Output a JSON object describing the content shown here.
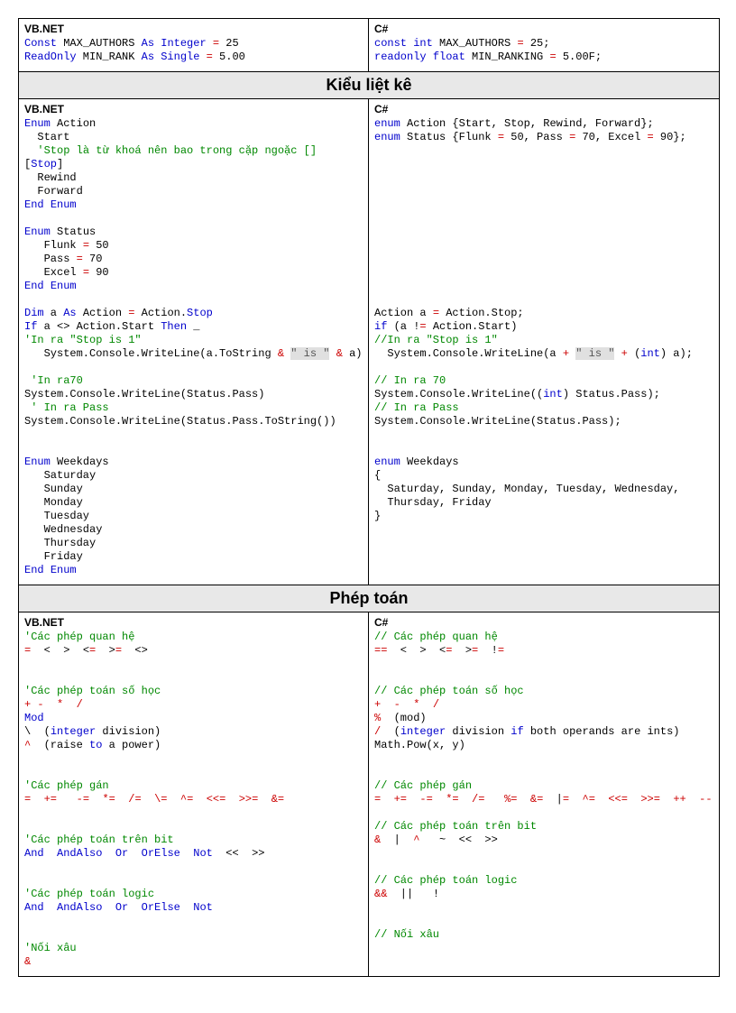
{
  "sections": [
    {
      "header": null,
      "left_lang": "VB.NET",
      "right_lang": "C#",
      "left_tokens": [
        [
          "kw",
          "Const"
        ],
        [
          "plain",
          " MAX_AUTHORS "
        ],
        [
          "kw",
          "As"
        ],
        [
          "plain",
          " "
        ],
        [
          "kw",
          "Integer"
        ],
        [
          "plain",
          " "
        ],
        [
          "op",
          "="
        ],
        [
          "plain",
          " 25\n"
        ],
        [
          "kw",
          "ReadOnly"
        ],
        [
          "plain",
          " MIN_RANK "
        ],
        [
          "kw",
          "As"
        ],
        [
          "plain",
          " "
        ],
        [
          "kw",
          "Single"
        ],
        [
          "plain",
          " "
        ],
        [
          "op",
          "="
        ],
        [
          "plain",
          " 5.00"
        ]
      ],
      "right_tokens": [
        [
          "kw",
          "const"
        ],
        [
          "plain",
          " "
        ],
        [
          "kw",
          "int"
        ],
        [
          "plain",
          " MAX_AUTHORS "
        ],
        [
          "op",
          "="
        ],
        [
          "plain",
          " 25;\n"
        ],
        [
          "kw",
          "readonly"
        ],
        [
          "plain",
          " "
        ],
        [
          "kw",
          "float"
        ],
        [
          "plain",
          " MIN_RANKING "
        ],
        [
          "op",
          "="
        ],
        [
          "plain",
          " 5.00F;"
        ]
      ]
    },
    {
      "header": "Kiểu liệt kê",
      "left_lang": "VB.NET",
      "right_lang": "C#",
      "left_tokens": [
        [
          "kw",
          "Enum"
        ],
        [
          "plain",
          " Action\n  Start\n  "
        ],
        [
          "cm",
          "'Stop là từ khoá nên bao trong cặp ngoặc []"
        ],
        [
          "plain",
          "\n["
        ],
        [
          "kw",
          "Stop"
        ],
        [
          "plain",
          "]\n  Rewind\n  Forward\n"
        ],
        [
          "kw",
          "End"
        ],
        [
          "plain",
          " "
        ],
        [
          "kw",
          "Enum"
        ],
        [
          "plain",
          "\n\n"
        ],
        [
          "kw",
          "Enum"
        ],
        [
          "plain",
          " Status\n   Flunk "
        ],
        [
          "op",
          "="
        ],
        [
          "plain",
          " 50\n   Pass "
        ],
        [
          "op",
          "="
        ],
        [
          "plain",
          " 70\n   Excel "
        ],
        [
          "op",
          "="
        ],
        [
          "plain",
          " 90\n"
        ],
        [
          "kw",
          "End"
        ],
        [
          "plain",
          " "
        ],
        [
          "kw",
          "Enum"
        ],
        [
          "plain",
          "\n\n"
        ],
        [
          "kw",
          "Dim"
        ],
        [
          "plain",
          " a "
        ],
        [
          "kw",
          "As"
        ],
        [
          "plain",
          " Action "
        ],
        [
          "op",
          "="
        ],
        [
          "plain",
          " Action."
        ],
        [
          "kw",
          "Stop"
        ],
        [
          "plain",
          "\n"
        ],
        [
          "kw",
          "If"
        ],
        [
          "plain",
          " a <> Action.Start "
        ],
        [
          "kw",
          "Then"
        ],
        [
          "plain",
          " _\n"
        ],
        [
          "cm",
          "'In ra \"Stop is 1\""
        ],
        [
          "plain",
          "\n   System.Console.WriteLine(a.ToString "
        ],
        [
          "op",
          "&"
        ],
        [
          "plain",
          " "
        ],
        [
          "str",
          "\" is \""
        ],
        [
          "plain",
          " "
        ],
        [
          "op",
          "&"
        ],
        [
          "plain",
          " a)\n\n"
        ],
        [
          "cm",
          " 'In ra70"
        ],
        [
          "plain",
          "\nSystem.Console.WriteLine(Status.Pass)\n"
        ],
        [
          "cm",
          " ' In ra Pass"
        ],
        [
          "plain",
          "\nSystem.Console.WriteLine(Status.Pass.ToString())\n\n\n"
        ],
        [
          "kw",
          "Enum"
        ],
        [
          "plain",
          " Weekdays\n   Saturday\n   Sunday\n   Monday\n   Tuesday\n   Wednesday\n   Thursday\n   Friday\n"
        ],
        [
          "kw",
          "End"
        ],
        [
          "plain",
          " "
        ],
        [
          "kw",
          "Enum"
        ]
      ],
      "right_tokens": [
        [
          "kw",
          "enum"
        ],
        [
          "plain",
          " Action {Start, Stop, Rewind, Forward};\n"
        ],
        [
          "kw",
          "enum"
        ],
        [
          "plain",
          " Status {Flunk "
        ],
        [
          "op",
          "="
        ],
        [
          "plain",
          " 50, Pass "
        ],
        [
          "op",
          "="
        ],
        [
          "plain",
          " 70, Excel "
        ],
        [
          "op",
          "="
        ],
        [
          "plain",
          " 90};\n\n\n\n\n\n\n\n\n\n\n\n\n"
        ],
        [
          "plain",
          "Action a "
        ],
        [
          "op",
          "="
        ],
        [
          "plain",
          " Action.Stop;\n"
        ],
        [
          "kw",
          "if"
        ],
        [
          "plain",
          " (a !"
        ],
        [
          "op",
          "="
        ],
        [
          "plain",
          " Action.Start)\n"
        ],
        [
          "cm",
          "//In ra \"Stop is 1\""
        ],
        [
          "plain",
          "\n  System.Console.WriteLine(a "
        ],
        [
          "op",
          "+"
        ],
        [
          "plain",
          " "
        ],
        [
          "str",
          "\" is \""
        ],
        [
          "plain",
          " "
        ],
        [
          "op",
          "+"
        ],
        [
          "plain",
          " ("
        ],
        [
          "kw",
          "int"
        ],
        [
          "plain",
          ") a);\n\n"
        ],
        [
          "cm",
          "// In ra 70"
        ],
        [
          "plain",
          "\nSystem.Console.WriteLine(("
        ],
        [
          "kw",
          "int"
        ],
        [
          "plain",
          ") Status.Pass);\n"
        ],
        [
          "cm",
          "// In ra Pass"
        ],
        [
          "plain",
          "\nSystem.Console.WriteLine(Status.Pass);\n\n\n"
        ],
        [
          "kw",
          "enum"
        ],
        [
          "plain",
          " Weekdays\n{\n  Saturday, Sunday, Monday, Tuesday, Wednesday,\n  Thursday, Friday\n}"
        ]
      ]
    },
    {
      "header": "Phép toán",
      "left_lang": "VB.NET",
      "right_lang": "C#",
      "left_tokens": [
        [
          "cm",
          "'Các phép quan hệ"
        ],
        [
          "plain",
          "\n"
        ],
        [
          "op",
          "="
        ],
        [
          "plain",
          "  <  >  <"
        ],
        [
          "op",
          "="
        ],
        [
          "plain",
          "  >"
        ],
        [
          "op",
          "="
        ],
        [
          "plain",
          "  <>\n\n\n"
        ],
        [
          "cm",
          "'Các phép toán số học"
        ],
        [
          "plain",
          "\n"
        ],
        [
          "op",
          "+"
        ],
        [
          "plain",
          " "
        ],
        [
          "op",
          "-"
        ],
        [
          "plain",
          "  "
        ],
        [
          "op",
          "*"
        ],
        [
          "plain",
          "  "
        ],
        [
          "op",
          "/"
        ],
        [
          "plain",
          "\n"
        ],
        [
          "kw",
          "Mod"
        ],
        [
          "plain",
          "\n\\  ("
        ],
        [
          "kw",
          "integer"
        ],
        [
          "plain",
          " division)\n"
        ],
        [
          "op",
          "^"
        ],
        [
          "plain",
          "  (raise "
        ],
        [
          "kw",
          "to"
        ],
        [
          "plain",
          " a power)\n\n\n"
        ],
        [
          "cm",
          "'Các phép gán"
        ],
        [
          "plain",
          "\n"
        ],
        [
          "op",
          "="
        ],
        [
          "plain",
          "  "
        ],
        [
          "op",
          "+="
        ],
        [
          "plain",
          "   "
        ],
        [
          "op",
          "-="
        ],
        [
          "plain",
          "  "
        ],
        [
          "op",
          "*="
        ],
        [
          "plain",
          "  "
        ],
        [
          "op",
          "/="
        ],
        [
          "plain",
          "  "
        ],
        [
          "op",
          "\\="
        ],
        [
          "plain",
          "  "
        ],
        [
          "op",
          "^="
        ],
        [
          "plain",
          "  "
        ],
        [
          "op",
          "<<="
        ],
        [
          "plain",
          "  "
        ],
        [
          "op",
          ">>="
        ],
        [
          "plain",
          "  "
        ],
        [
          "op",
          "&="
        ],
        [
          "plain",
          "\n\n\n"
        ],
        [
          "cm",
          "'Các phép toán trên bit"
        ],
        [
          "plain",
          "\n"
        ],
        [
          "kw",
          "And"
        ],
        [
          "plain",
          "  "
        ],
        [
          "kw",
          "AndAlso"
        ],
        [
          "plain",
          "  "
        ],
        [
          "kw",
          "Or"
        ],
        [
          "plain",
          "  "
        ],
        [
          "kw",
          "OrElse"
        ],
        [
          "plain",
          "  "
        ],
        [
          "kw",
          "Not"
        ],
        [
          "plain",
          "  <<  >>\n\n\n"
        ],
        [
          "cm",
          "'Các phép toán logic"
        ],
        [
          "plain",
          "\n"
        ],
        [
          "kw",
          "And"
        ],
        [
          "plain",
          "  "
        ],
        [
          "kw",
          "AndAlso"
        ],
        [
          "plain",
          "  "
        ],
        [
          "kw",
          "Or"
        ],
        [
          "plain",
          "  "
        ],
        [
          "kw",
          "OrElse"
        ],
        [
          "plain",
          "  "
        ],
        [
          "kw",
          "Not"
        ],
        [
          "plain",
          "\n\n\n"
        ],
        [
          "cm",
          "'Nối xâu"
        ],
        [
          "plain",
          "\n"
        ],
        [
          "op",
          "&"
        ]
      ],
      "right_tokens": [
        [
          "cm",
          "// Các phép quan hệ"
        ],
        [
          "plain",
          "\n"
        ],
        [
          "op",
          "="
        ],
        [
          "plain",
          "",
          ""
        ],
        [
          "op",
          "="
        ],
        [
          "plain",
          "  <  >  <"
        ],
        [
          "op",
          "="
        ],
        [
          "plain",
          "  >"
        ],
        [
          "op",
          "="
        ],
        [
          "plain",
          "  !"
        ],
        [
          "op",
          "="
        ],
        [
          "plain",
          "\n\n\n"
        ],
        [
          "cm",
          "// Các phép toán số học"
        ],
        [
          "plain",
          "\n"
        ],
        [
          "op",
          "+"
        ],
        [
          "plain",
          "  "
        ],
        [
          "op",
          "-"
        ],
        [
          "plain",
          "  "
        ],
        [
          "op",
          "*"
        ],
        [
          "plain",
          "  "
        ],
        [
          "op",
          "/"
        ],
        [
          "plain",
          "\n"
        ],
        [
          "op",
          "%"
        ],
        [
          "plain",
          "  (mod)\n"
        ],
        [
          "op",
          "/"
        ],
        [
          "plain",
          "  ("
        ],
        [
          "kw",
          "integer"
        ],
        [
          "plain",
          " division "
        ],
        [
          "kw",
          "if"
        ],
        [
          "plain",
          " both operands are ints)\nMath.Pow(x, y)\n\n\n"
        ],
        [
          "cm",
          "// Các phép gán"
        ],
        [
          "plain",
          "\n"
        ],
        [
          "op",
          "="
        ],
        [
          "plain",
          "  "
        ],
        [
          "op",
          "+="
        ],
        [
          "plain",
          "  "
        ],
        [
          "op",
          "-="
        ],
        [
          "plain",
          "  "
        ],
        [
          "op",
          "*="
        ],
        [
          "plain",
          "  "
        ],
        [
          "op",
          "/="
        ],
        [
          "plain",
          "   "
        ],
        [
          "op",
          "%="
        ],
        [
          "plain",
          "  "
        ],
        [
          "op",
          "&="
        ],
        [
          "plain",
          "  |"
        ],
        [
          "op",
          "="
        ],
        [
          "plain",
          "  "
        ],
        [
          "op",
          "^="
        ],
        [
          "plain",
          "  "
        ],
        [
          "op",
          "<<="
        ],
        [
          "plain",
          "  "
        ],
        [
          "op",
          ">>="
        ],
        [
          "plain",
          "  "
        ],
        [
          "op",
          "++"
        ],
        [
          "plain",
          "  "
        ],
        [
          "op",
          "--"
        ],
        [
          "plain",
          "\n\n"
        ],
        [
          "cm",
          "// Các phép toán trên bit"
        ],
        [
          "plain",
          "\n"
        ],
        [
          "op",
          "&"
        ],
        [
          "plain",
          "  |  "
        ],
        [
          "op",
          "^"
        ],
        [
          "plain",
          "   ~  <<  >>\n\n\n"
        ],
        [
          "cm",
          "// Các phép toán logic"
        ],
        [
          "plain",
          "\n"
        ],
        [
          "op",
          "&&"
        ],
        [
          "plain",
          "  ||   !\n\n\n"
        ],
        [
          "cm",
          "// Nối xâu"
        ]
      ]
    }
  ]
}
